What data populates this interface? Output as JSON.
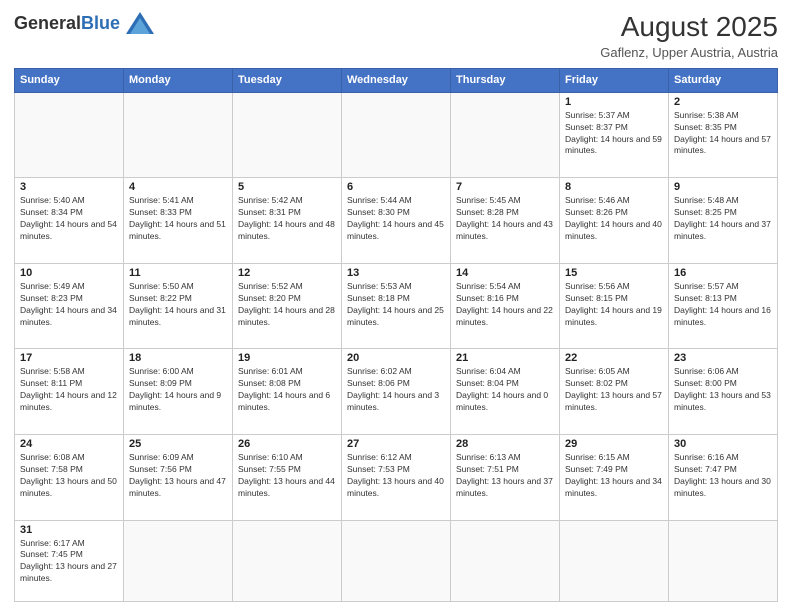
{
  "header": {
    "logo_general": "General",
    "logo_blue": "Blue",
    "month_year": "August 2025",
    "location": "Gaflenz, Upper Austria, Austria"
  },
  "days_of_week": [
    "Sunday",
    "Monday",
    "Tuesday",
    "Wednesday",
    "Thursday",
    "Friday",
    "Saturday"
  ],
  "weeks": [
    [
      {
        "day": "",
        "info": ""
      },
      {
        "day": "",
        "info": ""
      },
      {
        "day": "",
        "info": ""
      },
      {
        "day": "",
        "info": ""
      },
      {
        "day": "",
        "info": ""
      },
      {
        "day": "1",
        "info": "Sunrise: 5:37 AM\nSunset: 8:37 PM\nDaylight: 14 hours and 59 minutes."
      },
      {
        "day": "2",
        "info": "Sunrise: 5:38 AM\nSunset: 8:35 PM\nDaylight: 14 hours and 57 minutes."
      }
    ],
    [
      {
        "day": "3",
        "info": "Sunrise: 5:40 AM\nSunset: 8:34 PM\nDaylight: 14 hours and 54 minutes."
      },
      {
        "day": "4",
        "info": "Sunrise: 5:41 AM\nSunset: 8:33 PM\nDaylight: 14 hours and 51 minutes."
      },
      {
        "day": "5",
        "info": "Sunrise: 5:42 AM\nSunset: 8:31 PM\nDaylight: 14 hours and 48 minutes."
      },
      {
        "day": "6",
        "info": "Sunrise: 5:44 AM\nSunset: 8:30 PM\nDaylight: 14 hours and 45 minutes."
      },
      {
        "day": "7",
        "info": "Sunrise: 5:45 AM\nSunset: 8:28 PM\nDaylight: 14 hours and 43 minutes."
      },
      {
        "day": "8",
        "info": "Sunrise: 5:46 AM\nSunset: 8:26 PM\nDaylight: 14 hours and 40 minutes."
      },
      {
        "day": "9",
        "info": "Sunrise: 5:48 AM\nSunset: 8:25 PM\nDaylight: 14 hours and 37 minutes."
      }
    ],
    [
      {
        "day": "10",
        "info": "Sunrise: 5:49 AM\nSunset: 8:23 PM\nDaylight: 14 hours and 34 minutes."
      },
      {
        "day": "11",
        "info": "Sunrise: 5:50 AM\nSunset: 8:22 PM\nDaylight: 14 hours and 31 minutes."
      },
      {
        "day": "12",
        "info": "Sunrise: 5:52 AM\nSunset: 8:20 PM\nDaylight: 14 hours and 28 minutes."
      },
      {
        "day": "13",
        "info": "Sunrise: 5:53 AM\nSunset: 8:18 PM\nDaylight: 14 hours and 25 minutes."
      },
      {
        "day": "14",
        "info": "Sunrise: 5:54 AM\nSunset: 8:16 PM\nDaylight: 14 hours and 22 minutes."
      },
      {
        "day": "15",
        "info": "Sunrise: 5:56 AM\nSunset: 8:15 PM\nDaylight: 14 hours and 19 minutes."
      },
      {
        "day": "16",
        "info": "Sunrise: 5:57 AM\nSunset: 8:13 PM\nDaylight: 14 hours and 16 minutes."
      }
    ],
    [
      {
        "day": "17",
        "info": "Sunrise: 5:58 AM\nSunset: 8:11 PM\nDaylight: 14 hours and 12 minutes."
      },
      {
        "day": "18",
        "info": "Sunrise: 6:00 AM\nSunset: 8:09 PM\nDaylight: 14 hours and 9 minutes."
      },
      {
        "day": "19",
        "info": "Sunrise: 6:01 AM\nSunset: 8:08 PM\nDaylight: 14 hours and 6 minutes."
      },
      {
        "day": "20",
        "info": "Sunrise: 6:02 AM\nSunset: 8:06 PM\nDaylight: 14 hours and 3 minutes."
      },
      {
        "day": "21",
        "info": "Sunrise: 6:04 AM\nSunset: 8:04 PM\nDaylight: 14 hours and 0 minutes."
      },
      {
        "day": "22",
        "info": "Sunrise: 6:05 AM\nSunset: 8:02 PM\nDaylight: 13 hours and 57 minutes."
      },
      {
        "day": "23",
        "info": "Sunrise: 6:06 AM\nSunset: 8:00 PM\nDaylight: 13 hours and 53 minutes."
      }
    ],
    [
      {
        "day": "24",
        "info": "Sunrise: 6:08 AM\nSunset: 7:58 PM\nDaylight: 13 hours and 50 minutes."
      },
      {
        "day": "25",
        "info": "Sunrise: 6:09 AM\nSunset: 7:56 PM\nDaylight: 13 hours and 47 minutes."
      },
      {
        "day": "26",
        "info": "Sunrise: 6:10 AM\nSunset: 7:55 PM\nDaylight: 13 hours and 44 minutes."
      },
      {
        "day": "27",
        "info": "Sunrise: 6:12 AM\nSunset: 7:53 PM\nDaylight: 13 hours and 40 minutes."
      },
      {
        "day": "28",
        "info": "Sunrise: 6:13 AM\nSunset: 7:51 PM\nDaylight: 13 hours and 37 minutes."
      },
      {
        "day": "29",
        "info": "Sunrise: 6:15 AM\nSunset: 7:49 PM\nDaylight: 13 hours and 34 minutes."
      },
      {
        "day": "30",
        "info": "Sunrise: 6:16 AM\nSunset: 7:47 PM\nDaylight: 13 hours and 30 minutes."
      }
    ],
    [
      {
        "day": "31",
        "info": "Sunrise: 6:17 AM\nSunset: 7:45 PM\nDaylight: 13 hours and 27 minutes."
      },
      {
        "day": "",
        "info": ""
      },
      {
        "day": "",
        "info": ""
      },
      {
        "day": "",
        "info": ""
      },
      {
        "day": "",
        "info": ""
      },
      {
        "day": "",
        "info": ""
      },
      {
        "day": "",
        "info": ""
      }
    ]
  ]
}
